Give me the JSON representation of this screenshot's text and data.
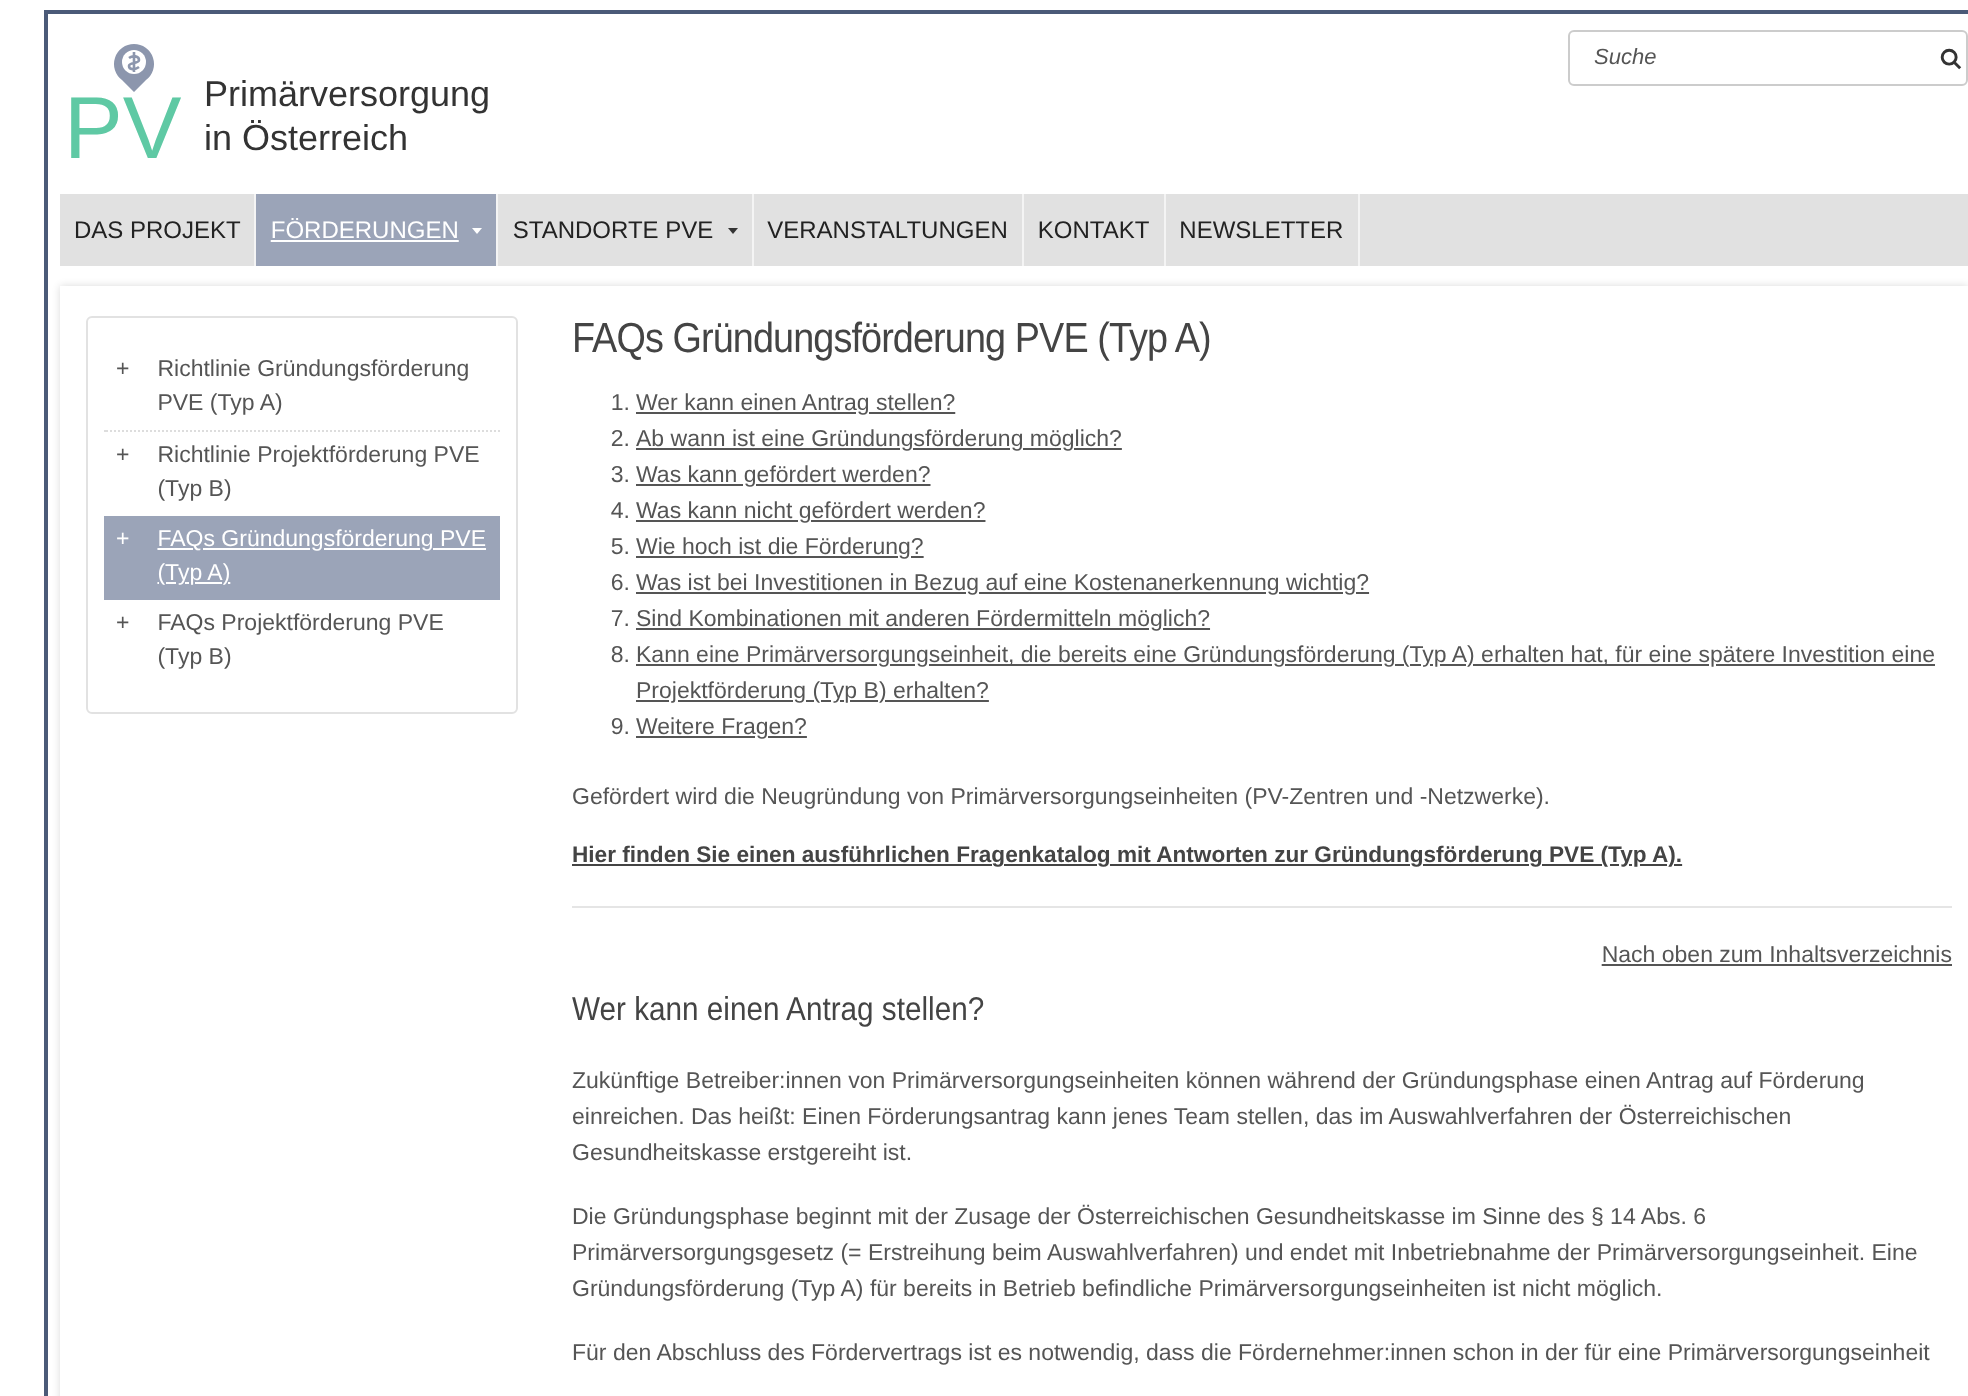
{
  "logo": {
    "letters": "PV",
    "line1": "Primärversorgung",
    "line2": "in Österreich"
  },
  "search": {
    "placeholder": "Suche"
  },
  "nav": [
    {
      "label": "DAS PROJEKT",
      "selected": false,
      "dropdown": false
    },
    {
      "label": "FÖRDERUNGEN",
      "selected": true,
      "dropdown": true
    },
    {
      "label": "STANDORTE PVE",
      "selected": false,
      "dropdown": true
    },
    {
      "label": "VERANSTALTUNGEN",
      "selected": false,
      "dropdown": false
    },
    {
      "label": "KONTAKT",
      "selected": false,
      "dropdown": false
    },
    {
      "label": "NEWSLETTER",
      "selected": false,
      "dropdown": false
    }
  ],
  "sidebar": {
    "items": [
      {
        "marker": "+",
        "label": "Richtlinie Gründungsförderung PVE (Typ A)",
        "selected": false
      },
      {
        "marker": "+",
        "label": "Richtlinie Projektförderung PVE (Typ B)",
        "selected": false
      },
      {
        "marker": "+",
        "label": "FAQs Gründungsförderung PVE (Typ A)",
        "selected": true
      },
      {
        "marker": "+",
        "label": "FAQs Projektförderung PVE (Typ B)",
        "selected": false
      }
    ]
  },
  "title": "FAQs Gründungsförderung PVE (Typ A)",
  "toc": [
    {
      "number": "1.",
      "label": "Wer kann einen Antrag stellen?"
    },
    {
      "number": "2.",
      "label": "Ab wann ist eine Gründungsförderung möglich?"
    },
    {
      "number": "3.",
      "label": "Was kann gefördert werden?"
    },
    {
      "number": "4.",
      "label": "Was kann nicht gefördert werden?"
    },
    {
      "number": "5.",
      "label": "Wie hoch ist die Förderung?"
    },
    {
      "number": "6.",
      "label": "Was ist bei Investitionen in Bezug auf eine Kostenanerkennung wichtig?"
    },
    {
      "number": "7.",
      "label": "Sind Kombinationen mit anderen Fördermitteln möglich?"
    },
    {
      "number": "8.",
      "label": "Kann eine Primärversorgungseinheit, die bereits eine Gründungsförderung (Typ A) erhalten hat, für eine spätere Investition eine Projektförderung (Typ B) erhalten?"
    },
    {
      "number": "9.",
      "label": "Weitere Fragen?"
    }
  ],
  "intro": "Gefördert wird die Neugründung von Primärversorgungseinheiten (PV-Zentren und -Netzwerke).",
  "catalog_link": "Hier finden Sie einen ausführlichen Fragenkatalog mit Antworten zur Gründungsförderung PVE (Typ A).",
  "back_link": "Nach oben zum Inhaltsverzeichnis",
  "section_title": "Wer kann einen Antrag stellen?",
  "paragraphs": [
    "Zukünftige Betreiber:innen von Primärversorgungseinheiten können während der Gründungsphase einen Antrag auf Förderung einreichen. Das heißt: Einen Förderungsantrag kann jenes Team stellen, das im Auswahlverfahren der Österreichischen Gesundheitskasse erstgereiht ist.",
    "Die Gründungsphase beginnt mit der Zusage der Österreichischen Gesundheitskasse im Sinne des § 14 Abs. 6 Primärversorgungsgesetz (= Erstreihung beim Auswahlverfahren) und endet mit Inbetriebnahme der Primärversorgungseinheit. Eine Gründungsförderung (Typ A) für bereits in Betrieb befindliche Primärversorgungseinheiten ist nicht möglich.",
    "Für den Abschluss des Fördervertrags ist es notwendig, dass die Fördernehmer:innen schon in der für eine Primärversorgungseinheit"
  ]
}
